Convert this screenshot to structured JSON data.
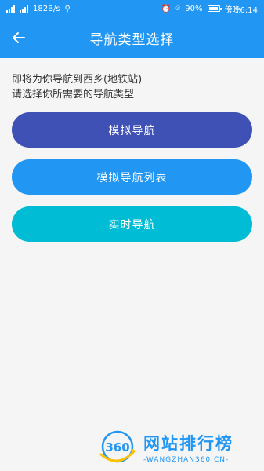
{
  "status_bar": {
    "left_net_1": "2G",
    "left_net_2": "4G",
    "speed": "182B/s",
    "usb_icon": "usb-icon",
    "alarm_icon": "alarm-icon",
    "location_icon": "location-icon",
    "battery_percent": "90%",
    "time": "傍晚6:14"
  },
  "app_bar": {
    "back_icon": "back-arrow-icon",
    "title": "导航类型选择"
  },
  "prompt": {
    "line1": "即将为你导航到西乡(地铁站)",
    "line2": "请选择你所需要的导航类型"
  },
  "buttons": {
    "simulated": "模拟导航",
    "simulated_list": "模拟导航列表",
    "realtime": "实时导航"
  },
  "colors": {
    "primary": "#2196F3",
    "indigo": "#3F51B5",
    "cyan": "#00BCD4",
    "background": "#f5f5f5"
  },
  "watermark": {
    "title": "网站排行榜",
    "subtitle": "-WANGZHAN360.CN-",
    "logo_text": "360"
  }
}
